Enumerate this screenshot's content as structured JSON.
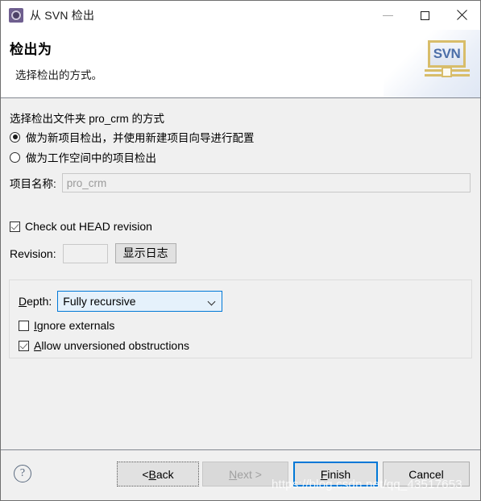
{
  "window": {
    "title": "从 SVN 检出",
    "icon": "svn-repository-icon",
    "controls": {
      "minimize": "minimize-icon",
      "maximize": "maximize-icon",
      "close": "close-icon"
    }
  },
  "header": {
    "title": "检出为",
    "description": "选择检出的方式。",
    "logo_text": "SVN"
  },
  "main": {
    "section_label": "选择检出文件夹 pro_crm 的方式",
    "radios": [
      {
        "label": "做为新项目检出，并使用新建项目向导进行配置",
        "checked": true
      },
      {
        "label": "做为工作空间中的项目检出",
        "checked": false
      }
    ],
    "project_name": {
      "label": "项目名称:",
      "value": "pro_crm"
    },
    "head_revision": {
      "label": "Check out HEAD revision",
      "checked": true
    },
    "revision": {
      "label": "Revision:",
      "value": "",
      "show_log_button": "显示日志"
    },
    "depth_group": {
      "depth_label": "Depth:",
      "depth_mnemonic": "D",
      "depth_label_rest": "epth:",
      "depth_value": "Fully recursive",
      "options": [
        {
          "label": "Ignore externals",
          "checked": false,
          "mnemonic": "I",
          "rest": "gnore externals"
        },
        {
          "label": "Allow unversioned obstructions",
          "checked": true,
          "mnemonic": "A",
          "rest": "llow unversioned obstructions"
        }
      ]
    }
  },
  "footer": {
    "help": "?",
    "buttons": {
      "back_prefix": "< ",
      "back_mnemonic": "B",
      "back_rest": "ack",
      "next_mnemonic": "N",
      "next_rest": "ext >",
      "finish_mnemonic": "F",
      "finish_rest": "inish",
      "cancel": "Cancel"
    }
  },
  "watermark": "https://blog.csdn.net/qq_43517653",
  "colors": {
    "accent": "#0078d7",
    "dialog_bg": "#f0f0f0",
    "header_bg": "#ffffff",
    "combo_bg": "#e5f1fb",
    "logo_border": "#d8bd6a",
    "logo_text": "#4b6ea8"
  }
}
